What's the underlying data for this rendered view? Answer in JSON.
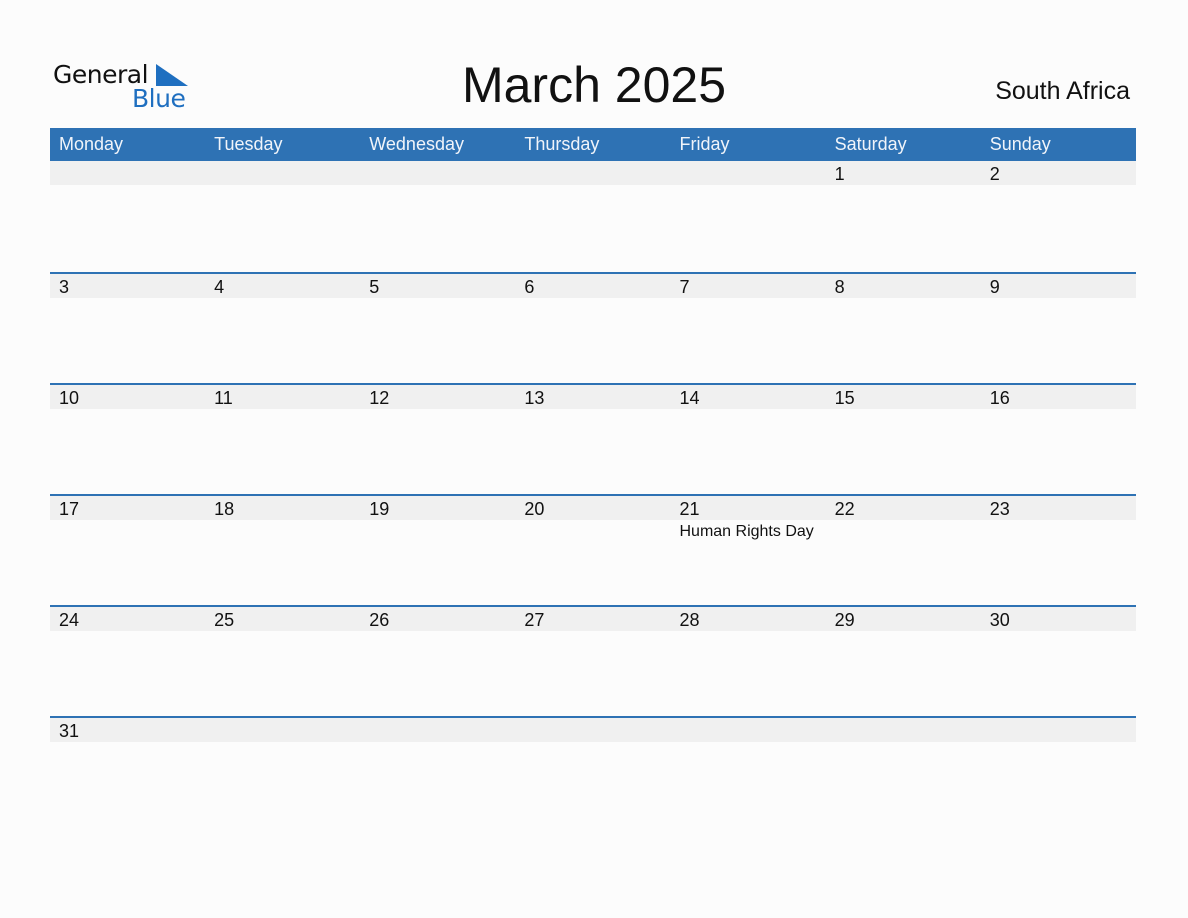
{
  "logo": {
    "line1": "General",
    "line2": "Blue"
  },
  "title": "March 2025",
  "country": "South Africa",
  "colors": {
    "header_bg": "#2e72b4",
    "accent_blue": "#1f6fc0",
    "date_row_bg": "#f0f0f0"
  },
  "weekdays": [
    "Monday",
    "Tuesday",
    "Wednesday",
    "Thursday",
    "Friday",
    "Saturday",
    "Sunday"
  ],
  "weeks": [
    [
      {
        "day": ""
      },
      {
        "day": ""
      },
      {
        "day": ""
      },
      {
        "day": ""
      },
      {
        "day": ""
      },
      {
        "day": "1"
      },
      {
        "day": "2"
      }
    ],
    [
      {
        "day": "3"
      },
      {
        "day": "4"
      },
      {
        "day": "5"
      },
      {
        "day": "6"
      },
      {
        "day": "7"
      },
      {
        "day": "8"
      },
      {
        "day": "9"
      }
    ],
    [
      {
        "day": "10"
      },
      {
        "day": "11"
      },
      {
        "day": "12"
      },
      {
        "day": "13"
      },
      {
        "day": "14"
      },
      {
        "day": "15"
      },
      {
        "day": "16"
      }
    ],
    [
      {
        "day": "17"
      },
      {
        "day": "18"
      },
      {
        "day": "19"
      },
      {
        "day": "20"
      },
      {
        "day": "21",
        "holiday": "Human Rights Day"
      },
      {
        "day": "22"
      },
      {
        "day": "23"
      }
    ],
    [
      {
        "day": "24"
      },
      {
        "day": "25"
      },
      {
        "day": "26"
      },
      {
        "day": "27"
      },
      {
        "day": "28"
      },
      {
        "day": "29"
      },
      {
        "day": "30"
      }
    ],
    [
      {
        "day": "31"
      },
      {
        "day": ""
      },
      {
        "day": ""
      },
      {
        "day": ""
      },
      {
        "day": ""
      },
      {
        "day": ""
      },
      {
        "day": ""
      }
    ]
  ]
}
